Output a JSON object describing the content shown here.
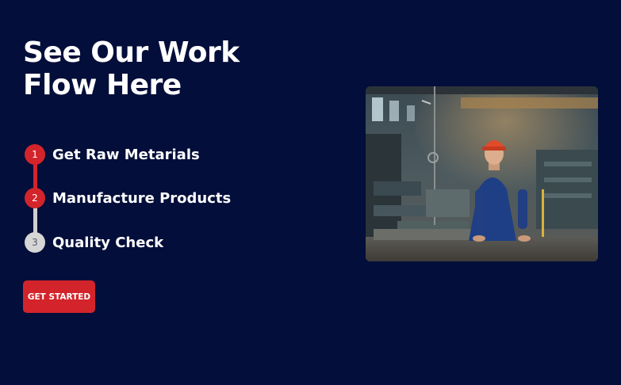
{
  "section": {
    "heading_line1": "See Our Work",
    "heading_line2": "Flow Here"
  },
  "steps": [
    {
      "number": "1",
      "label": "Get Raw Metarials",
      "state": "completed"
    },
    {
      "number": "2",
      "label": "Manufacture Products",
      "state": "completed"
    },
    {
      "number": "3",
      "label": "Quality Check",
      "state": "pending"
    }
  ],
  "cta": {
    "label": "GET STARTED"
  },
  "colors": {
    "background": "#030e3a",
    "accent": "#d3242b",
    "pending": "#d6d6d6"
  },
  "image": {
    "description_icon": "factory-worker-photo"
  }
}
